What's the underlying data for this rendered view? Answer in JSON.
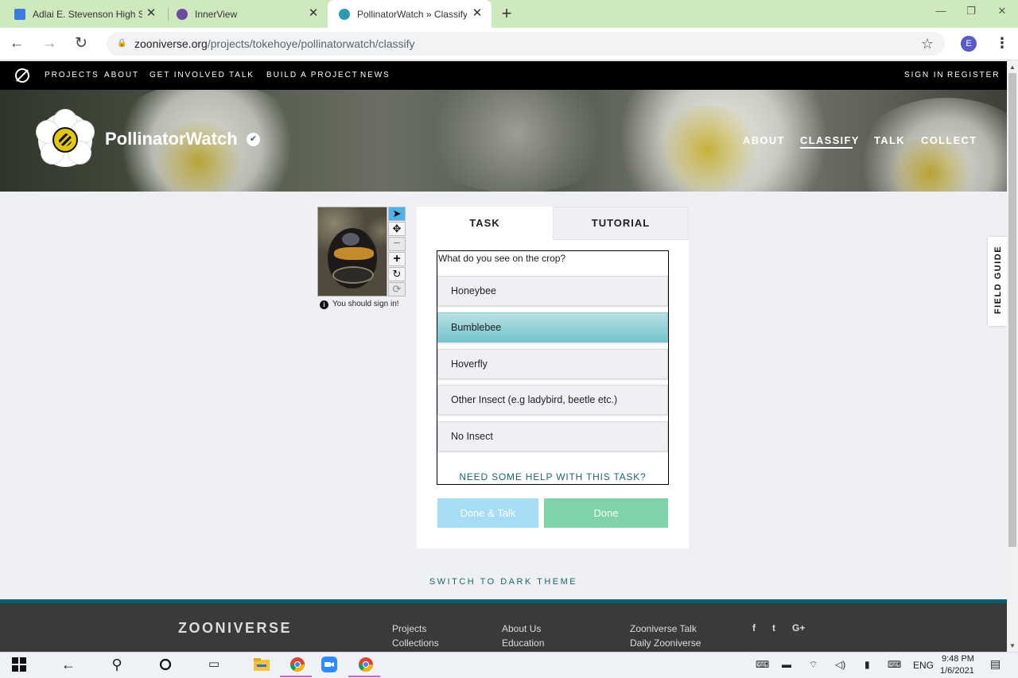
{
  "browser": {
    "tabs": [
      {
        "title": "Adlai E. Stevenson High School",
        "favicon_color": "#3b7be0"
      },
      {
        "title": "InnerView",
        "favicon_color": "#6d4aa3"
      },
      {
        "title": "PollinatorWatch » Classify — Z",
        "favicon_color": "#2a9bb0"
      }
    ],
    "new_tab": "+",
    "window_buttons": {
      "minimize": "—",
      "restore": "❐",
      "close": "✕"
    },
    "nav": {
      "back": "←",
      "forward": "→",
      "reload": "↻"
    },
    "url_host": "zooniverse.org",
    "url_path": "/projects/tokehoye/pollinatorwatch/classify",
    "star": "☆",
    "profile_initial": "E",
    "menu": "⋮"
  },
  "site_nav": {
    "items": [
      "PROJECTS",
      "ABOUT",
      "GET INVOLVED",
      "TALK",
      "BUILD A PROJECT",
      "NEWS"
    ],
    "sign_in": "SIGN IN",
    "register": "REGISTER"
  },
  "project": {
    "name": "PollinatorWatch",
    "verified_icon": "✔",
    "nav": [
      "ABOUT",
      "CLASSIFY",
      "TALK",
      "COLLECT"
    ],
    "active_nav": "CLASSIFY"
  },
  "viewer": {
    "tools": [
      "pointer-icon",
      "move-icon",
      "zoom-out-icon",
      "zoom-in-icon",
      "rotate-icon",
      "reset-icon"
    ],
    "tool_glyphs": [
      "➤",
      "✥",
      "−",
      "+",
      "↻",
      "⟳"
    ],
    "sign_in_note": "You should sign in!",
    "info_icon": "i"
  },
  "task_panel": {
    "tabs": [
      "TASK",
      "TUTORIAL"
    ],
    "active_tab": "TASK",
    "question": "What do you see on the crop?",
    "answers": [
      "Honeybee",
      "Bumblebee",
      "Hoverfly",
      "Other Insect (e.g ladybird, beetle etc.)",
      "No Insect"
    ],
    "selected_answer": "Bumblebee",
    "help": "NEED SOME HELP WITH THIS TASK?",
    "done_talk": "Done & Talk",
    "done": "Done"
  },
  "field_guide": "FIELD GUIDE",
  "dark_theme": "SWITCH TO DARK THEME",
  "footer": {
    "logo": "ZOONIVERSE",
    "col1": [
      "Projects",
      "Collections"
    ],
    "col2": [
      "About Us",
      "Education"
    ],
    "col3": [
      "Zooniverse Talk",
      "Daily Zooniverse"
    ],
    "social": [
      "f",
      "t",
      "G+"
    ]
  },
  "taskbar": {
    "language": "ENG",
    "time": "9:48 PM",
    "date": "1/6/2021"
  },
  "colors": {
    "selected_answer": "#72c3cc",
    "done_button": "#7ed3a8",
    "done_talk_button": "#a6dcf5",
    "accent_teal": "#1c6470",
    "tab_bar": "#cfe9bf"
  }
}
